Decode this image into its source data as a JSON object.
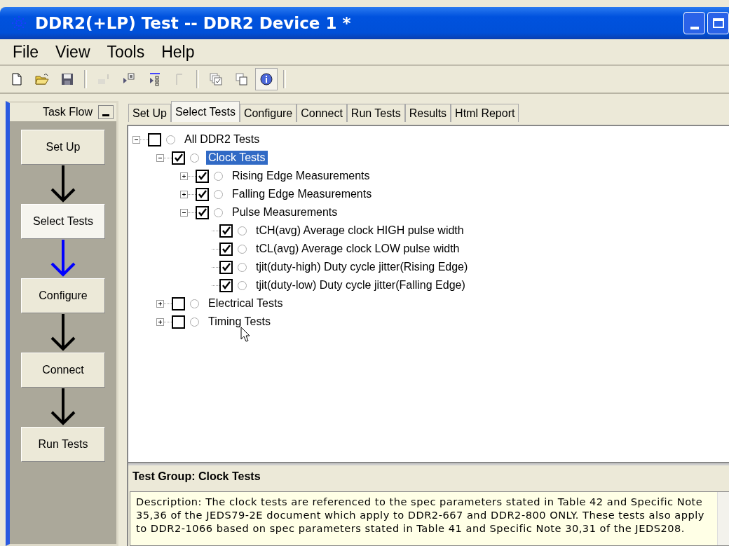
{
  "window": {
    "title": "DDR2(+LP) Test -- DDR2 Device 1 *"
  },
  "menu": [
    "File",
    "View",
    "Tools",
    "Help"
  ],
  "toolbar": [
    {
      "kind": "new",
      "disabled": false,
      "pressed": false
    },
    {
      "kind": "open",
      "disabled": false,
      "pressed": false
    },
    {
      "kind": "save",
      "disabled": false,
      "pressed": false
    },
    {
      "kind": "separator"
    },
    {
      "kind": "chart",
      "disabled": true,
      "pressed": false
    },
    {
      "kind": "check",
      "disabled": false,
      "pressed": false
    },
    {
      "kind": "list",
      "disabled": false,
      "pressed": false
    },
    {
      "kind": "bracket",
      "disabled": true,
      "pressed": false
    },
    {
      "kind": "separator"
    },
    {
      "kind": "stack",
      "disabled": false,
      "pressed": false
    },
    {
      "kind": "pages",
      "disabled": false,
      "pressed": false
    },
    {
      "kind": "info",
      "disabled": false,
      "pressed": true
    },
    {
      "kind": "separator"
    }
  ],
  "task_flow": {
    "title": "Task Flow",
    "steps": [
      {
        "label": "Set Up",
        "selected": false
      },
      {
        "label": "Select Tests",
        "selected": true
      },
      {
        "label": "Configure",
        "selected": false
      },
      {
        "label": "Connect",
        "selected": false
      },
      {
        "label": "Run Tests",
        "selected": false
      }
    ]
  },
  "tabs": [
    {
      "label": "Set Up",
      "selected": false
    },
    {
      "label": "Select Tests",
      "selected": true
    },
    {
      "label": "Configure",
      "selected": false
    },
    {
      "label": "Connect",
      "selected": false
    },
    {
      "label": "Run Tests",
      "selected": false
    },
    {
      "label": "Results",
      "selected": false
    },
    {
      "label": "Html Report",
      "selected": false
    }
  ],
  "tree": [
    {
      "label": "All DDR2 Tests",
      "checked": false,
      "on": false,
      "selected": false,
      "expanded": true,
      "children": [
        {
          "label": "Clock Tests",
          "checked": true,
          "on": false,
          "selected": true,
          "expanded": true,
          "children": [
            {
              "label": "Rising Edge Measurements",
              "checked": true,
              "on": false,
              "selected": false,
              "expanded": false
            },
            {
              "label": "Falling Edge Measurements",
              "checked": true,
              "on": false,
              "selected": false,
              "expanded": false
            },
            {
              "label": "Pulse Measurements",
              "checked": true,
              "on": false,
              "selected": false,
              "expanded": true,
              "children": [
                {
                  "label": "tCH(avg) Average clock HIGH pulse width",
                  "checked": true,
                  "on": false,
                  "selected": false
                },
                {
                  "label": "tCL(avg) Average clock LOW pulse width",
                  "checked": true,
                  "on": false,
                  "selected": false
                },
                {
                  "label": "tjit(duty-high) Duty cycle jitter(Rising Edge)",
                  "checked": true,
                  "on": false,
                  "selected": false
                },
                {
                  "label": "tjit(duty-low) Duty cycle jitter(Falling Edge)",
                  "checked": true,
                  "on": false,
                  "selected": false
                }
              ]
            }
          ]
        },
        {
          "label": "Electrical Tests",
          "checked": false,
          "on": false,
          "selected": false,
          "expanded": false
        },
        {
          "label": "Timing Tests",
          "checked": false,
          "on": false,
          "selected": false,
          "expanded": false
        }
      ]
    }
  ],
  "info": {
    "title": "Test Group: Clock Tests",
    "description": "Description: The clock tests are referenced to the spec parameters stated in Table 42 and Specific Note 35,36 of the JEDS79-2E document which apply to DDR2-667 and DDR2-800 ONLY. These tests also apply to DDR2-1066 based on spec parameters stated in Table 41 and Specific Note 30,31 of the JEDS208."
  }
}
